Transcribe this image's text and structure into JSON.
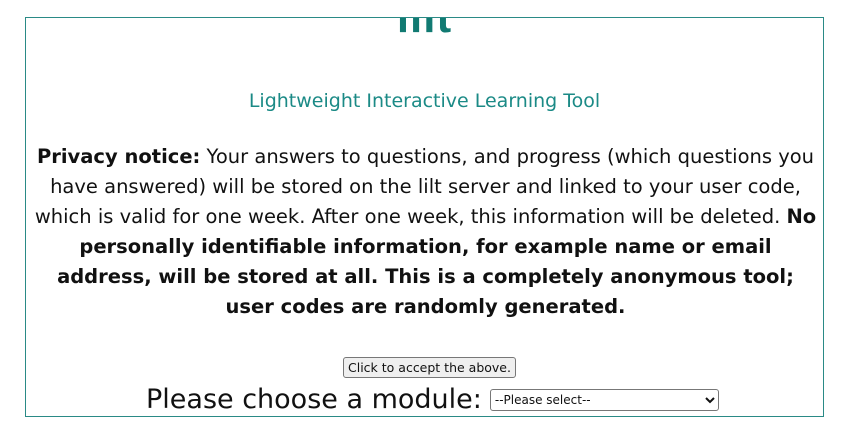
{
  "logo_text": "lilt",
  "subtitle": "Lightweight Interactive Learning Tool",
  "privacy": {
    "heading": "Privacy notice:",
    "body": " Your answers to questions, and progress (which questions you have answered) will be stored on the lilt server and linked to your user code, which is valid for one week. After one week, this information will be deleted. ",
    "bold_tail": "No personally identifiable information, for example name or email address, will be stored at all. This is a completely anonymous tool; user codes are randomly generated."
  },
  "accept_button": "Click to accept the above.",
  "module": {
    "label": "Please choose a module:",
    "selected": "--Please select--"
  },
  "colors": {
    "accent": "#1b8a86",
    "border": "#2a8a86"
  }
}
